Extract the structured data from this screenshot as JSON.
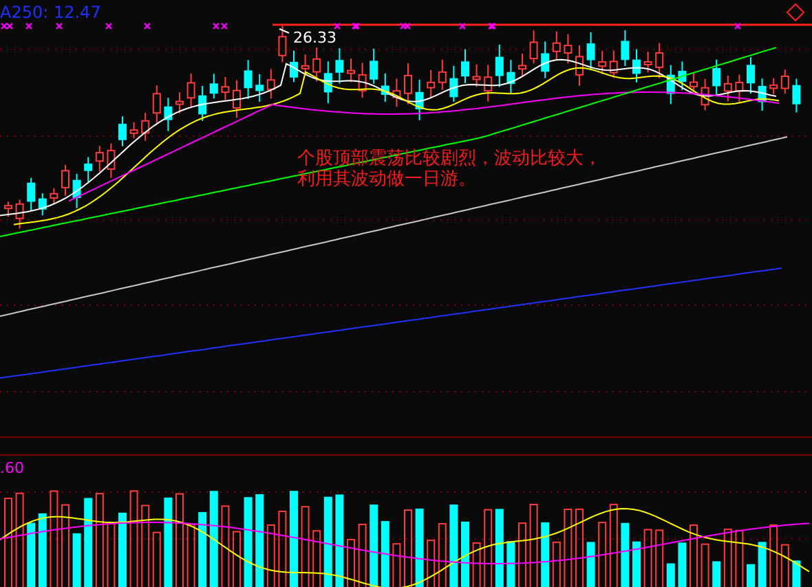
{
  "price_panel": {
    "legend": "A250: 12.47",
    "peak_label": "26.33",
    "annotation": [
      "个股顶部震荡比较剧烈，波动比较大，",
      "利用其波动做一日游。"
    ]
  },
  "volume_panel": {
    "legend": ".60"
  }
}
